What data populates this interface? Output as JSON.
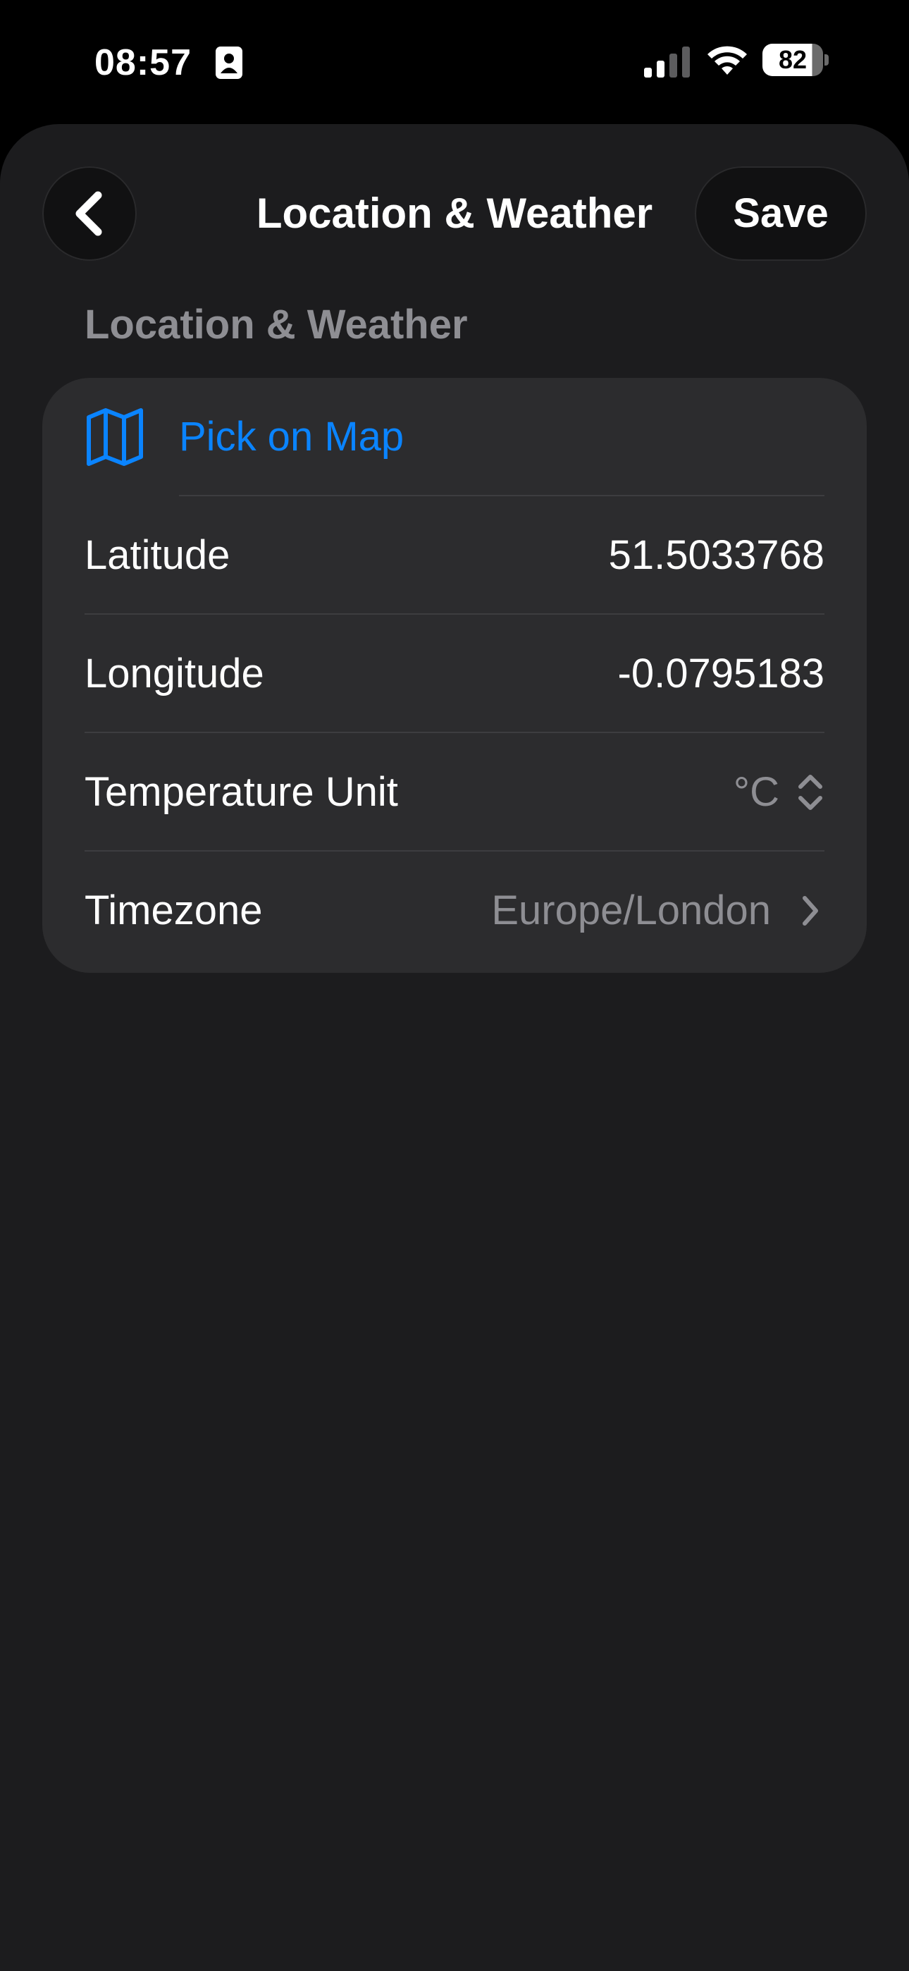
{
  "status_bar": {
    "time": "08:57",
    "battery_level": "82",
    "icons": [
      "contact-card-icon",
      "cellular-signal-icon",
      "wifi-icon",
      "battery-icon"
    ]
  },
  "nav": {
    "title": "Location & Weather",
    "save_label": "Save",
    "back_icon": "chevron-left-icon"
  },
  "section": {
    "header": "Location & Weather"
  },
  "rows": {
    "pick_on_map": {
      "label": "Pick on Map",
      "icon": "map-icon"
    },
    "latitude": {
      "label": "Latitude",
      "value": "51.5033768"
    },
    "longitude": {
      "label": "Longitude",
      "value": "-0.0795183"
    },
    "temperature_unit": {
      "label": "Temperature Unit",
      "value": "°C",
      "icon": "chevron-up-down-icon"
    },
    "timezone": {
      "label": "Timezone",
      "value": "Europe/London",
      "icon": "chevron-right-icon"
    }
  },
  "colors": {
    "background": "#1c1c1e",
    "card": "#2c2c2e",
    "accent": "#0a84ff",
    "secondary_text": "#8e8e93"
  }
}
